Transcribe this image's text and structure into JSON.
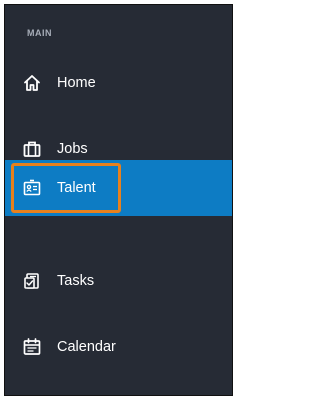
{
  "sidebar": {
    "section_label": "MAIN",
    "items": [
      {
        "label": "Home",
        "icon": "home-icon"
      },
      {
        "label": "Jobs",
        "icon": "briefcase-icon"
      },
      {
        "label": "Talent",
        "icon": "id-card-icon",
        "active": true
      },
      {
        "label": "Tasks",
        "icon": "tasks-icon"
      },
      {
        "label": "Calendar",
        "icon": "calendar-icon"
      }
    ]
  },
  "colors": {
    "sidebar_bg": "#262b35",
    "active_bg": "#0d7cc4",
    "highlight": "#e8811d",
    "section_label": "#a7adb8"
  }
}
